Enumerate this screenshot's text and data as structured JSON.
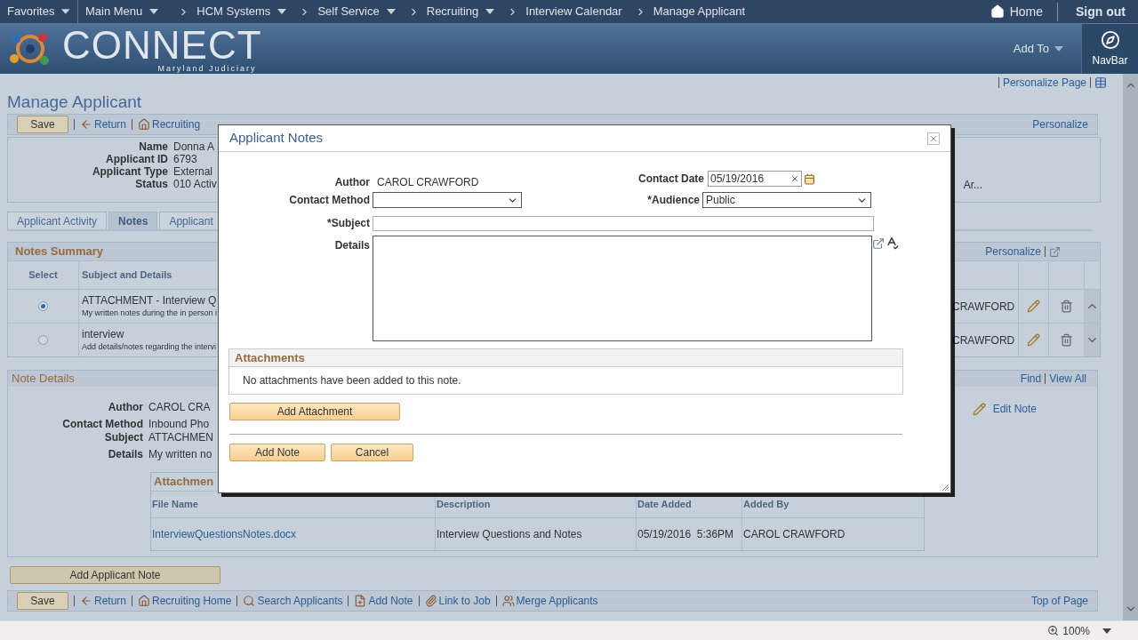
{
  "top_nav": {
    "menus": [
      {
        "label": "Favorites"
      },
      {
        "label": "Main Menu"
      }
    ],
    "breadcrumbs": [
      {
        "label": "HCM Systems",
        "dropdown": true
      },
      {
        "label": "Self Service",
        "dropdown": true
      },
      {
        "label": "Recruiting",
        "dropdown": true
      },
      {
        "label": "Interview Calendar",
        "dropdown": false
      },
      {
        "label": "Manage Applicant",
        "dropdown": false
      }
    ],
    "home": "Home",
    "sign_out": "Sign out"
  },
  "banner": {
    "logo": "CONNECT",
    "subtitle": "Maryland Judiciary",
    "add_to": "Add To",
    "navbar": "NavBar"
  },
  "page": {
    "personalize_page": "Personalize Page",
    "title": "Manage Applicant",
    "toolbar": {
      "save": "Save",
      "links": [
        "Return",
        "Recruiting"
      ],
      "personalize": "Personalize"
    },
    "applicant": {
      "fields": [
        {
          "label": "Name",
          "value": "Donna A"
        },
        {
          "label": "Applicant ID",
          "value": "6793"
        },
        {
          "label": "Applicant Type",
          "value": "External"
        },
        {
          "label": "Status",
          "value": "010 Activ"
        }
      ],
      "right_text": "Ar..."
    },
    "tabs": [
      {
        "label": "Applicant Activity",
        "selected": false
      },
      {
        "label": "Notes",
        "selected": true
      },
      {
        "label": "Applicant",
        "selected": false
      }
    ],
    "notes_summary": {
      "title": "Notes Summary",
      "personalize": "Personalize",
      "columns": [
        "Select",
        "Subject and Details"
      ],
      "rows": [
        {
          "selected": true,
          "subject": "ATTACHMENT - Interview Q",
          "details": "My written notes during the in person i",
          "author": "CRAWFORD"
        },
        {
          "selected": false,
          "subject": "interview",
          "details": "Add details/notes regarding the intervi",
          "author": "CRAWFORD"
        }
      ]
    },
    "note_details": {
      "title": "Note Details",
      "find": "Find",
      "view_all": "View All",
      "edit_note": "Edit Note",
      "fields": [
        {
          "label": "Author",
          "value": "CAROL CRA"
        },
        {
          "label": "Contact Method",
          "value": "Inbound Pho"
        },
        {
          "label": "Subject",
          "value": "ATTACHMEN"
        },
        {
          "label": "Details",
          "value": "My written no"
        }
      ],
      "attachments": {
        "title": "Attachmen",
        "columns": [
          "File Name",
          "Description",
          "Date Added",
          "Added By"
        ],
        "rows": [
          [
            "InterviewQuestionsNotes.docx",
            "Interview Questions and Notes",
            "05/19/2016  5:36PM",
            "CAROL CRAWFORD"
          ]
        ]
      }
    },
    "add_applicant_note": "Add Applicant Note",
    "bottom_toolbar": {
      "save": "Save",
      "links": [
        "Return",
        "Recruiting Home",
        "Search Applicants",
        "Add Note",
        "Link to Job",
        "Merge Applicants"
      ],
      "top_of_page": "Top of Page"
    }
  },
  "dialog": {
    "title": "Applicant Notes",
    "author_label": "Author",
    "author": "CAROL CRAWFORD",
    "contact_date_label": "Contact Date",
    "contact_date": "05/19/2016",
    "contact_method_label": "Contact Method",
    "audience_label": "*Audience",
    "audience": "Public",
    "subject_label": "*Subject",
    "details_label": "Details",
    "attachments_title": "Attachments",
    "attachments_empty": "No attachments have been added to this note.",
    "add_attachment": "Add Attachment",
    "add_note": "Add Note",
    "cancel": "Cancel"
  },
  "status_bar": {
    "zoom": "100%"
  }
}
